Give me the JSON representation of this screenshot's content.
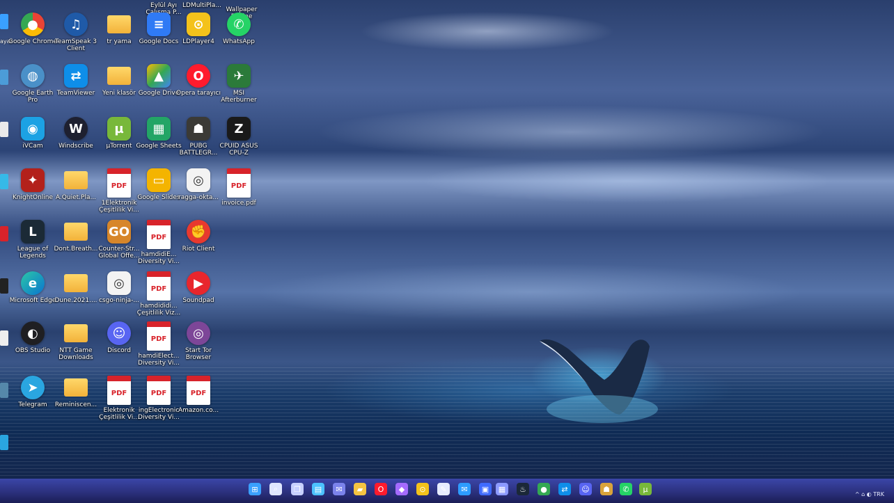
{
  "desktop": {
    "columns": [
      {
        "icons": [
          {
            "label": "Google Chrome",
            "icon": "chrome-icon"
          },
          {
            "label": "Google Earth Pro",
            "icon": "google-earth-icon"
          },
          {
            "label": "iVCam",
            "icon": "ivcam-icon"
          },
          {
            "label": "KnightOnline",
            "icon": "knightonline-icon"
          },
          {
            "label": "League of Legends",
            "icon": "league-of-legends-icon"
          },
          {
            "label": "Microsoft Edge",
            "icon": "edge-icon"
          },
          {
            "label": "OBS Studio",
            "icon": "obs-icon"
          },
          {
            "label": "Telegram",
            "icon": "telegram-icon"
          }
        ]
      },
      {
        "icons": [
          {
            "label": "TeamSpeak 3 Client",
            "icon": "teamspeak-icon"
          },
          {
            "label": "TeamViewer",
            "icon": "teamviewer-icon"
          },
          {
            "label": "Windscribe",
            "icon": "windscribe-icon"
          },
          {
            "label": "A.Quiet.Pla...",
            "icon": "folder-icon"
          },
          {
            "label": "Dont.Breath...",
            "icon": "folder-icon"
          },
          {
            "label": "Dune.2021....",
            "icon": "folder-icon"
          },
          {
            "label": "NTT Game Downloads",
            "icon": "folder-icon"
          },
          {
            "label": "Reminiscen...",
            "icon": "folder-icon"
          }
        ]
      },
      {
        "icons": [
          {
            "label": "tr yama",
            "icon": "folder-icon"
          },
          {
            "label": "Yeni klasör",
            "icon": "folder-icon"
          },
          {
            "label": "µTorrent",
            "icon": "utorrent-icon"
          },
          {
            "label": "1Elektronik Çeşitlilik Vi...",
            "icon": "pdf-icon"
          },
          {
            "label": "Counter-Str... Global Offe...",
            "icon": "csgo-icon"
          },
          {
            "label": "csgo-ninja-...",
            "icon": "media-file-icon"
          },
          {
            "label": "Discord",
            "icon": "discord-icon"
          },
          {
            "label": "Elektronik Çeşitlilik Vi...",
            "icon": "pdf-icon"
          }
        ]
      },
      {
        "icons": [
          {
            "label": "Google Docs",
            "icon": "google-docs-icon"
          },
          {
            "label": "Google Drive",
            "icon": "google-drive-icon"
          },
          {
            "label": "Google Sheets",
            "icon": "google-sheets-icon"
          },
          {
            "label": "Google Slides",
            "icon": "google-slides-icon"
          },
          {
            "label": "hamdidiE... Diversity Vi...",
            "icon": "pdf-icon"
          },
          {
            "label": "hamdididi... Çeşitlilik Viz...",
            "icon": "pdf-icon"
          },
          {
            "label": "hamdiElect... Diversity Vi...",
            "icon": "pdf-icon"
          },
          {
            "label": "ingElectronic Diversity Vi...",
            "icon": "pdf-icon"
          }
        ]
      },
      {
        "icons": [
          {
            "label": "LDPlayer4",
            "icon": "ldplayer-icon"
          },
          {
            "label": "Opera tarayıcı",
            "icon": "opera-icon"
          },
          {
            "label": "PUBG BATTLEGR...",
            "icon": "pubg-icon"
          },
          {
            "label": "ragga-okta...",
            "icon": "media-file-icon"
          },
          {
            "label": "Riot Client",
            "icon": "riot-client-icon"
          },
          {
            "label": "Soundpad",
            "icon": "soundpad-icon"
          },
          {
            "label": "Start Tor Browser",
            "icon": "tor-browser-icon"
          },
          {
            "label": "Amazon.co...",
            "icon": "pdf-icon"
          }
        ]
      },
      {
        "icons": [
          {
            "label": "WhatsApp",
            "icon": "whatsapp-icon"
          },
          {
            "label": "MSI Afterburner",
            "icon": "msi-afterburner-icon"
          },
          {
            "label": "CPUID ASUS CPU-Z",
            "icon": "cpuz-icon"
          },
          {
            "label": "invoice.pdf",
            "icon": "pdf-icon"
          }
        ]
      }
    ],
    "top_partial_labels": [
      "Eylül Ayı Çalışma P...",
      "LDMultiPla...",
      "Wallpaper Engine"
    ],
    "edge_labels": [
      "ayar",
      "Pro"
    ]
  },
  "taskbar": {
    "items": [
      {
        "name": "start-button",
        "icon": "windows-start-icon",
        "color": "#3aa0ff"
      },
      {
        "name": "search-button",
        "icon": "search-icon",
        "color": "#dfe6ff"
      },
      {
        "name": "task-view-button",
        "icon": "task-view-icon",
        "color": "#c7d0ff"
      },
      {
        "name": "widgets-button",
        "icon": "widgets-icon",
        "color": "#4cc2ff"
      },
      {
        "name": "chat-button",
        "icon": "chat-icon",
        "color": "#7b83eb"
      },
      {
        "name": "file-explorer-button",
        "icon": "folder-icon",
        "color": "#f5c342"
      },
      {
        "name": "opera-button",
        "icon": "opera-icon",
        "color": "#ff1b2d"
      },
      {
        "name": "app-button",
        "icon": "app-icon",
        "color": "#a56bff"
      },
      {
        "name": "ldplayer-button",
        "icon": "ldplayer-icon",
        "color": "#f4c21b"
      },
      {
        "name": "notepad-button",
        "icon": "notepad-icon",
        "color": "#e7ecff"
      },
      {
        "name": "mail-button",
        "icon": "mail-icon",
        "color": "#2d9cff"
      },
      {
        "name": "store-button",
        "icon": "store-icon",
        "color": "#3f6bff"
      },
      {
        "name": "calculator-button",
        "icon": "calculator-icon",
        "color": "#8c9aff"
      },
      {
        "name": "steam-button",
        "icon": "steam-icon",
        "color": "#1b2838"
      },
      {
        "name": "chrome-button",
        "icon": "chrome-icon",
        "color": "#34a853"
      },
      {
        "name": "teamviewer-button",
        "icon": "teamviewer-icon",
        "color": "#0e8ee9"
      },
      {
        "name": "discord-button",
        "icon": "discord-icon",
        "color": "#5865f2"
      },
      {
        "name": "pubg-button",
        "icon": "pubg-icon",
        "color": "#d9a33b"
      },
      {
        "name": "whatsapp-button",
        "icon": "whatsapp-icon",
        "color": "#25d366"
      },
      {
        "name": "utorrent-button",
        "icon": "utorrent-icon",
        "color": "#78b83a"
      }
    ],
    "tray_label": "^  ⌂  ◐   TRK"
  }
}
